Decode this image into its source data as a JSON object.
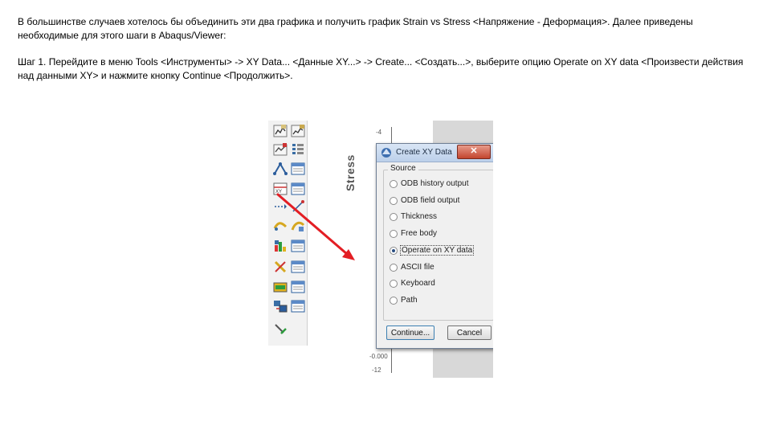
{
  "text": {
    "paragraph1": "В большинстве случаев хотелось бы объединить эти два графика и получить график Strain vs Stress <Напряжение - Деформация>. Далее приведены необходимые для этого шаги в Abaqus/Viewer:",
    "paragraph2": "Шаг 1. Перейдите в меню Tools <Инструменты> -> XY Data... <Данные XY...> -> Create... <Создать...>, выберите опцию Operate on XY data <Произвести действия над данными XY> и нажмите кнопку Continue <Продолжить>."
  },
  "plot": {
    "ylabel": "Stress",
    "tick_top": "-4",
    "tick_bottom": "-12",
    "tick_zero": "-0.000"
  },
  "dialog": {
    "title": "Create XY Data",
    "close_label": "✕",
    "source_label": "Source",
    "options": [
      {
        "label": "ODB history output",
        "selected": false
      },
      {
        "label": "ODB field output",
        "selected": false
      },
      {
        "label": "Thickness",
        "selected": false
      },
      {
        "label": "Free body",
        "selected": false
      },
      {
        "label": "Operate on XY data",
        "selected": true
      },
      {
        "label": "ASCII file",
        "selected": false
      },
      {
        "label": "Keyboard",
        "selected": false
      },
      {
        "label": "Path",
        "selected": false
      }
    ],
    "continue_label": "Continue...",
    "cancel_label": "Cancel"
  },
  "toolbar": {
    "icons": [
      [
        "plot-chart-icon",
        "plot-chart-edit-icon"
      ],
      [
        "plot-history-icon",
        "plot-list-icon"
      ],
      [
        "xy-create-icon",
        "xy-manager-icon"
      ],
      [
        "xy-data-create-icon",
        "xy-data-manager-icon"
      ],
      [
        "path-create-icon",
        "path-manager-icon"
      ],
      [
        "animate-icon",
        "animate-options-icon"
      ],
      [
        "display-group-icon",
        "display-group-manager-icon"
      ],
      [
        "probe-icon",
        "probe-options-icon"
      ],
      [
        "view-cut-icon",
        "view-cut-manager-icon"
      ],
      [
        "stream-icon",
        "stream-manager-icon"
      ],
      [
        "query-tool-icon"
      ]
    ]
  },
  "colors": {
    "arrow": "#e31e24",
    "titlebar": "#c9dbf0",
    "close_button": "#c9533c"
  }
}
